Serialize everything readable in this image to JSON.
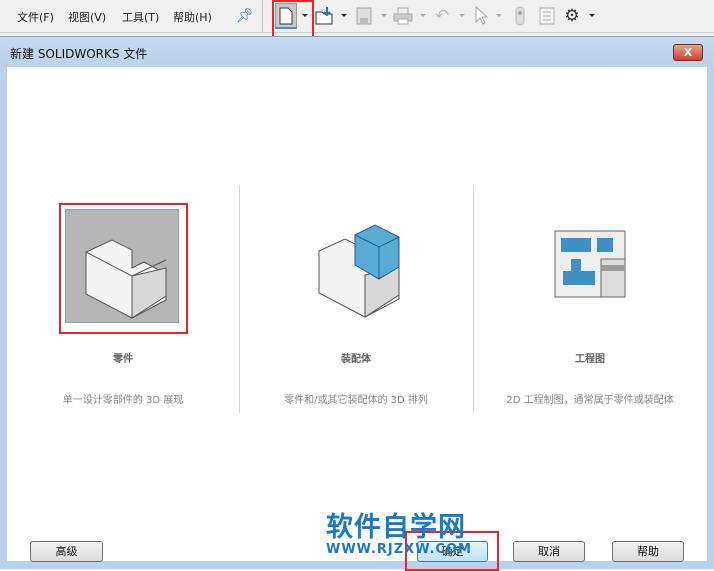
{
  "menu": [
    "文件(F)",
    "视图(V)",
    "工具(T)",
    "帮助(H)"
  ],
  "toolbar_icons": [
    "new-document-icon",
    "open-icon",
    "save-icon",
    "print-icon",
    "undo-icon",
    "select-icon",
    "rebuild-icon",
    "options-list-icon",
    "gear-icon"
  ],
  "dialog": {
    "title": "新建 SOLIDWORKS 文件",
    "close": "X"
  },
  "cards": [
    {
      "title": "零件",
      "desc": "单一设计零部件的 3D 展现"
    },
    {
      "title": "装配体",
      "desc": "零件和/或其它装配体的 3D 排列"
    },
    {
      "title": "工程图",
      "desc": "2D 工程制图，通常属于零件或装配体"
    }
  ],
  "buttons": {
    "advanced": "高级",
    "ok": "确定",
    "cancel": "取消",
    "help": "帮助"
  },
  "watermark": {
    "title": "软件自学网",
    "url": "WWW.RJZXW.COM"
  },
  "colors": {
    "highlight": "#e8262a",
    "accent": "#1a7ac9"
  }
}
